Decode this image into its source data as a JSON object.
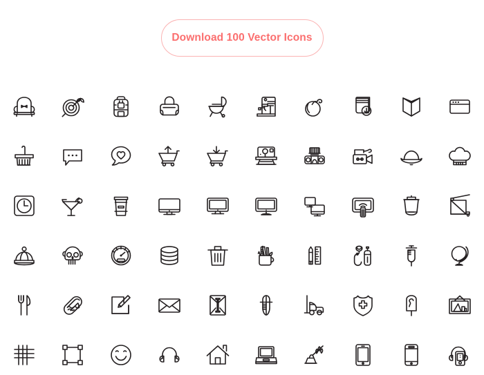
{
  "page": {
    "background_color": "#ffffff",
    "stroke_color": "#231f20"
  },
  "cta": {
    "label": "Download 100 Vector Icons",
    "text_color": "#fb6f6f",
    "border_color": "#fbb3b3",
    "icon_count": 100
  },
  "icon_grid": {
    "columns": 10,
    "rows": 6,
    "visible_count": 60,
    "icons": [
      {
        "name": "armchair-icon",
        "label": "Armchair"
      },
      {
        "name": "target-arrow-icon",
        "label": "Target with arrow"
      },
      {
        "name": "backpack-icon",
        "label": "Backpack"
      },
      {
        "name": "duffel-bag-icon",
        "label": "Duffel bag"
      },
      {
        "name": "bbq-grill-icon",
        "label": "BBQ grill"
      },
      {
        "name": "sewing-machine-icon",
        "label": "Sewing machine"
      },
      {
        "name": "bomb-icon",
        "label": "Bomb"
      },
      {
        "name": "book-download-icon",
        "label": "Book with download arrow"
      },
      {
        "name": "open-book-icon",
        "label": "Open book"
      },
      {
        "name": "browser-window-icon",
        "label": "Browser window"
      },
      {
        "name": "paint-brush-icon",
        "label": "Paint brush"
      },
      {
        "name": "chat-bubble-icon",
        "label": "Chat bubble with dots"
      },
      {
        "name": "heart-bubble-icon",
        "label": "Heart in speech bubble"
      },
      {
        "name": "cart-upload-icon",
        "label": "Shopping cart with up arrow"
      },
      {
        "name": "cart-download-icon",
        "label": "Shopping cart with down arrow"
      },
      {
        "name": "instant-camera-icon",
        "label": "Instant camera"
      },
      {
        "name": "boombox-icon",
        "label": "Boombox radio"
      },
      {
        "name": "video-camera-icon",
        "label": "Video camera"
      },
      {
        "name": "bowler-hat-icon",
        "label": "Bowler hat"
      },
      {
        "name": "chef-hat-icon",
        "label": "Chef hat"
      },
      {
        "name": "clock-icon",
        "label": "Clock"
      },
      {
        "name": "cocktail-glass-icon",
        "label": "Cocktail glass"
      },
      {
        "name": "coffee-cup-icon",
        "label": "Coffee cup"
      },
      {
        "name": "imac-monitor-icon",
        "label": "All-in-one monitor"
      },
      {
        "name": "computer-monitor-icon",
        "label": "Computer monitor"
      },
      {
        "name": "desktop-display-icon",
        "label": "Desktop display"
      },
      {
        "name": "dual-screens-icon",
        "label": "Two screens"
      },
      {
        "name": "smart-tv-remote-icon",
        "label": "Smart TV with remote"
      },
      {
        "name": "cooking-pot-icon",
        "label": "Cooking pot"
      },
      {
        "name": "paper-trimmer-icon",
        "label": "Paper trimmer"
      },
      {
        "name": "crown-icon",
        "label": "Crown"
      },
      {
        "name": "skull-icon",
        "label": "Skull"
      },
      {
        "name": "speedometer-icon",
        "label": "Speedometer gauge"
      },
      {
        "name": "database-icon",
        "label": "Database"
      },
      {
        "name": "trash-can-icon",
        "label": "Trash can"
      },
      {
        "name": "pencil-cup-icon",
        "label": "Desk pencil cup"
      },
      {
        "name": "pencil-ruler-icon",
        "label": "Pencil and ruler"
      },
      {
        "name": "diving-gear-icon",
        "label": "Diving mask and tank"
      },
      {
        "name": "syringe-icon",
        "label": "Syringe"
      },
      {
        "name": "globe-icon",
        "label": "Desk globe"
      },
      {
        "name": "fork-knife-icon",
        "label": "Fork and knife"
      },
      {
        "name": "hot-dog-icon",
        "label": "Hot dog"
      },
      {
        "name": "edit-note-icon",
        "label": "Edit note"
      },
      {
        "name": "envelope-icon",
        "label": "Envelope"
      },
      {
        "name": "document-envelope-icon",
        "label": "Paper envelope"
      },
      {
        "name": "pen-nib-icon",
        "label": "Fountain pen nib"
      },
      {
        "name": "forklift-icon",
        "label": "Forklift"
      },
      {
        "name": "medical-shield-icon",
        "label": "Shield with medical cross"
      },
      {
        "name": "popsicle-icon",
        "label": "Popsicle"
      },
      {
        "name": "framed-picture-icon",
        "label": "Framed picture"
      },
      {
        "name": "grid-icon",
        "label": "Grid"
      },
      {
        "name": "selection-box-icon",
        "label": "Selection box with handles"
      },
      {
        "name": "smiley-face-icon",
        "label": "Smiley face"
      },
      {
        "name": "headphones-icon",
        "label": "Headphones"
      },
      {
        "name": "home-icon",
        "label": "Home"
      },
      {
        "name": "laptop-icon",
        "label": "Laptop"
      },
      {
        "name": "quill-inkwell-icon",
        "label": "Quill and inkwell"
      },
      {
        "name": "tablet-icon",
        "label": "Tablet"
      },
      {
        "name": "smartphone-icon",
        "label": "Smartphone"
      },
      {
        "name": "mp3-player-icon",
        "label": "MP3 player with headphones"
      }
    ]
  }
}
